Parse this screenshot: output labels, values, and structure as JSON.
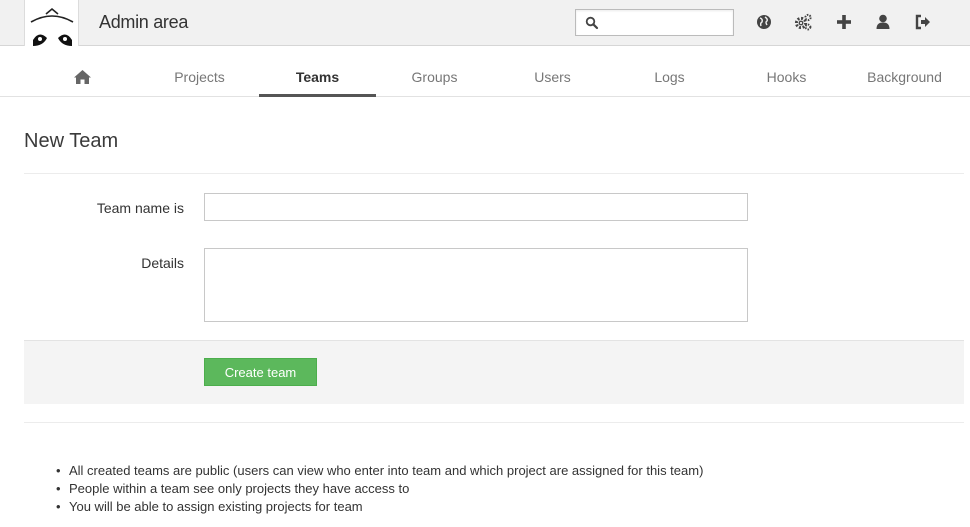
{
  "header": {
    "title": "Admin area",
    "search": {
      "value": "",
      "placeholder": ""
    },
    "icons": [
      "search-icon",
      "globe-icon",
      "gears-icon",
      "plus-icon",
      "user-icon",
      "sign-out-icon"
    ]
  },
  "nav": {
    "items": [
      {
        "label": "",
        "icon": "home-icon"
      },
      {
        "label": "Projects"
      },
      {
        "label": "Teams",
        "active": true
      },
      {
        "label": "Groups"
      },
      {
        "label": "Users"
      },
      {
        "label": "Logs"
      },
      {
        "label": "Hooks"
      },
      {
        "label": "Background"
      }
    ]
  },
  "page": {
    "title": "New Team",
    "form": {
      "name_label": "Team name is",
      "name_value": "",
      "details_label": "Details",
      "details_value": "",
      "submit_label": "Create team"
    },
    "notes": [
      "All created teams are public (users can view who enter into team and which project are assigned for this team)",
      "People within a team see only projects they have access to",
      "You will be able to assign existing projects for team"
    ]
  },
  "colors": {
    "accent": "#5cb85c",
    "header_bg": "#f1f1f1",
    "active_tab_border": "#555555"
  }
}
